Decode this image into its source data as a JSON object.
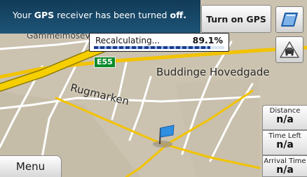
{
  "banner": {
    "text_pre": "Your",
    "text_bold1": "GPS",
    "text_mid": "receiver has been turned",
    "text_bold2": "off."
  },
  "buttons": {
    "turn_on_gps": "Turn on GPS",
    "menu": "Menu"
  },
  "recalculating": {
    "label": "Recalculating...",
    "percent_text": "89.1%",
    "progress": 0.891
  },
  "map": {
    "road_shield": "E55",
    "streets": {
      "gammelmose": "Gammelmosev",
      "buddinge": "Buddinge Hovedgade",
      "rugmarken": "Rugmarken"
    }
  },
  "info_panel": {
    "distance": {
      "label": "Distance",
      "value": "n/a"
    },
    "time_left": {
      "label": "Time Left",
      "value": "n/a"
    },
    "arrival_time": {
      "label": "Arrival Time",
      "value": "n/a"
    }
  },
  "colors": {
    "banner": "#1d5477",
    "road_shield": "#0c8a2c",
    "route": "#f2c300",
    "flag": "#2f8fe0"
  }
}
